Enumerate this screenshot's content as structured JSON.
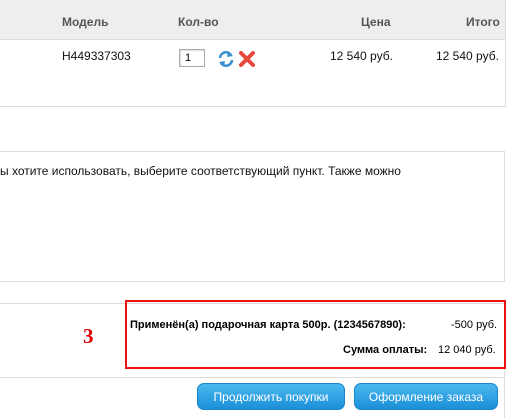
{
  "cart": {
    "headers": {
      "model": "Модель",
      "qty": "Кол-во",
      "price": "Цена",
      "total": "Итого"
    },
    "row": {
      "model": "H449337303",
      "qty": "1",
      "price": "12 540 руб.",
      "total": "12 540 руб."
    }
  },
  "info": {
    "text": "ы хотите использовать, выберите соответствующий пункт. Также можно"
  },
  "annotation": {
    "number": "3",
    "color": "#ee1111"
  },
  "totals": {
    "gift_card_label": "Применён(а) подарочная карта 500р. (1234567890):",
    "gift_card_value": "-500 руб.",
    "sum_label": "Сумма оплаты:",
    "sum_value": "12 040 руб."
  },
  "buttons": {
    "continue": "Продолжить покупки",
    "checkout": "Оформление заказа"
  },
  "icons": {
    "refresh": "refresh-icon",
    "remove": "remove-icon"
  }
}
